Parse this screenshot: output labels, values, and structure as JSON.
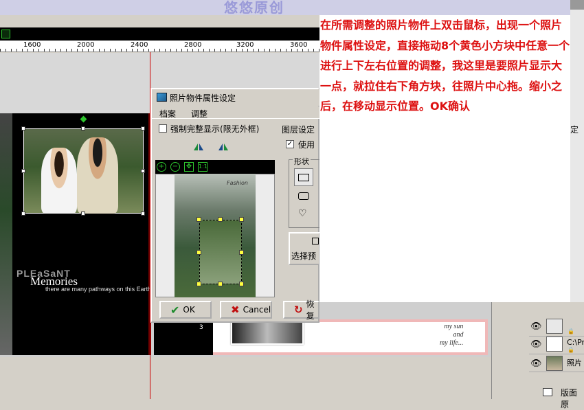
{
  "banner": {
    "title": "悠悠原创"
  },
  "ruler": {
    "ticks": [
      "1600",
      "2000",
      "2400",
      "2800",
      "3200",
      "3600"
    ]
  },
  "canvas": {
    "pleasant": "PLEaSaNT",
    "memories": "Memories",
    "pathways": "there are many pathways on this Earth",
    "script_lines": [
      "my sun",
      "and",
      "my life..."
    ],
    "small_mark": "3"
  },
  "dialog": {
    "title": "照片物件属性设定",
    "menu": [
      "档案",
      "调整"
    ],
    "force_full_display": "强制完整显示(限无外框)",
    "layer_settings": "图层设定",
    "use_label": "使用",
    "shape_group": "形状",
    "preset_button": "选择预",
    "preview_logo": "Fashion",
    "zoom_tools": [
      "zoom-in",
      "zoom-out",
      "fit",
      "1:1"
    ],
    "fit_label": "1:1",
    "ok": "OK",
    "cancel": "Cancel",
    "restore": "恢复"
  },
  "annotation": {
    "text": "在所需调整的照片物件上双击鼠标，出现一个照片物件属性设定，直接拖动8个黄色小方块中任意一个进行上下左右位置的调整，我这里是要照片显示大一点，就拉住右下角方块，往照片中心拖。缩小之后，在移动显示位置。OK确认",
    "color": "#dd1111"
  },
  "right_panel": {
    "tab_label": "定",
    "layers": [
      {
        "name": ""
      },
      {
        "name": "C:\\Pr"
      },
      {
        "name": "照片"
      }
    ],
    "bottom_label": "版面原"
  }
}
